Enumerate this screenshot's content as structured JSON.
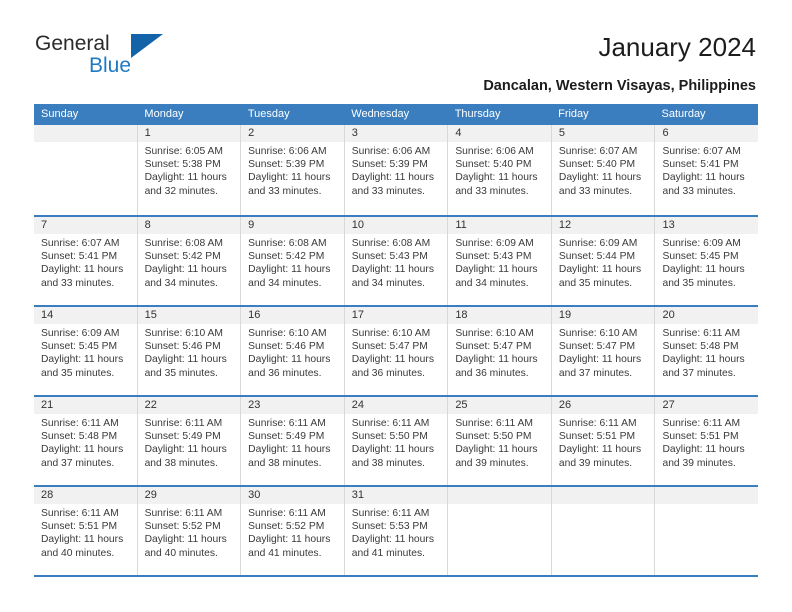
{
  "brand": {
    "line1": "General",
    "line2": "Blue",
    "logo_icon": "triangle-logo-icon",
    "blue": "#1f7ac4"
  },
  "header": {
    "title": "January 2024",
    "subtitle": "Dancalan, Western Visayas, Philippines"
  },
  "colors": {
    "header_blue": "#3a7ebf",
    "day_band_gray": "#f1f1f1",
    "text": "#3a3a3a"
  },
  "calendar": {
    "weekdays": [
      "Sunday",
      "Monday",
      "Tuesday",
      "Wednesday",
      "Thursday",
      "Friday",
      "Saturday"
    ],
    "weeks": [
      [
        {
          "day": "",
          "sunrise": "",
          "sunset": "",
          "daylight1": "",
          "daylight2": ""
        },
        {
          "day": "1",
          "sunrise": "Sunrise: 6:05 AM",
          "sunset": "Sunset: 5:38 PM",
          "daylight1": "Daylight: 11 hours",
          "daylight2": "and 32 minutes."
        },
        {
          "day": "2",
          "sunrise": "Sunrise: 6:06 AM",
          "sunset": "Sunset: 5:39 PM",
          "daylight1": "Daylight: 11 hours",
          "daylight2": "and 33 minutes."
        },
        {
          "day": "3",
          "sunrise": "Sunrise: 6:06 AM",
          "sunset": "Sunset: 5:39 PM",
          "daylight1": "Daylight: 11 hours",
          "daylight2": "and 33 minutes."
        },
        {
          "day": "4",
          "sunrise": "Sunrise: 6:06 AM",
          "sunset": "Sunset: 5:40 PM",
          "daylight1": "Daylight: 11 hours",
          "daylight2": "and 33 minutes."
        },
        {
          "day": "5",
          "sunrise": "Sunrise: 6:07 AM",
          "sunset": "Sunset: 5:40 PM",
          "daylight1": "Daylight: 11 hours",
          "daylight2": "and 33 minutes."
        },
        {
          "day": "6",
          "sunrise": "Sunrise: 6:07 AM",
          "sunset": "Sunset: 5:41 PM",
          "daylight1": "Daylight: 11 hours",
          "daylight2": "and 33 minutes."
        }
      ],
      [
        {
          "day": "7",
          "sunrise": "Sunrise: 6:07 AM",
          "sunset": "Sunset: 5:41 PM",
          "daylight1": "Daylight: 11 hours",
          "daylight2": "and 33 minutes."
        },
        {
          "day": "8",
          "sunrise": "Sunrise: 6:08 AM",
          "sunset": "Sunset: 5:42 PM",
          "daylight1": "Daylight: 11 hours",
          "daylight2": "and 34 minutes."
        },
        {
          "day": "9",
          "sunrise": "Sunrise: 6:08 AM",
          "sunset": "Sunset: 5:42 PM",
          "daylight1": "Daylight: 11 hours",
          "daylight2": "and 34 minutes."
        },
        {
          "day": "10",
          "sunrise": "Sunrise: 6:08 AM",
          "sunset": "Sunset: 5:43 PM",
          "daylight1": "Daylight: 11 hours",
          "daylight2": "and 34 minutes."
        },
        {
          "day": "11",
          "sunrise": "Sunrise: 6:09 AM",
          "sunset": "Sunset: 5:43 PM",
          "daylight1": "Daylight: 11 hours",
          "daylight2": "and 34 minutes."
        },
        {
          "day": "12",
          "sunrise": "Sunrise: 6:09 AM",
          "sunset": "Sunset: 5:44 PM",
          "daylight1": "Daylight: 11 hours",
          "daylight2": "and 35 minutes."
        },
        {
          "day": "13",
          "sunrise": "Sunrise: 6:09 AM",
          "sunset": "Sunset: 5:45 PM",
          "daylight1": "Daylight: 11 hours",
          "daylight2": "and 35 minutes."
        }
      ],
      [
        {
          "day": "14",
          "sunrise": "Sunrise: 6:09 AM",
          "sunset": "Sunset: 5:45 PM",
          "daylight1": "Daylight: 11 hours",
          "daylight2": "and 35 minutes."
        },
        {
          "day": "15",
          "sunrise": "Sunrise: 6:10 AM",
          "sunset": "Sunset: 5:46 PM",
          "daylight1": "Daylight: 11 hours",
          "daylight2": "and 35 minutes."
        },
        {
          "day": "16",
          "sunrise": "Sunrise: 6:10 AM",
          "sunset": "Sunset: 5:46 PM",
          "daylight1": "Daylight: 11 hours",
          "daylight2": "and 36 minutes."
        },
        {
          "day": "17",
          "sunrise": "Sunrise: 6:10 AM",
          "sunset": "Sunset: 5:47 PM",
          "daylight1": "Daylight: 11 hours",
          "daylight2": "and 36 minutes."
        },
        {
          "day": "18",
          "sunrise": "Sunrise: 6:10 AM",
          "sunset": "Sunset: 5:47 PM",
          "daylight1": "Daylight: 11 hours",
          "daylight2": "and 36 minutes."
        },
        {
          "day": "19",
          "sunrise": "Sunrise: 6:10 AM",
          "sunset": "Sunset: 5:47 PM",
          "daylight1": "Daylight: 11 hours",
          "daylight2": "and 37 minutes."
        },
        {
          "day": "20",
          "sunrise": "Sunrise: 6:11 AM",
          "sunset": "Sunset: 5:48 PM",
          "daylight1": "Daylight: 11 hours",
          "daylight2": "and 37 minutes."
        }
      ],
      [
        {
          "day": "21",
          "sunrise": "Sunrise: 6:11 AM",
          "sunset": "Sunset: 5:48 PM",
          "daylight1": "Daylight: 11 hours",
          "daylight2": "and 37 minutes."
        },
        {
          "day": "22",
          "sunrise": "Sunrise: 6:11 AM",
          "sunset": "Sunset: 5:49 PM",
          "daylight1": "Daylight: 11 hours",
          "daylight2": "and 38 minutes."
        },
        {
          "day": "23",
          "sunrise": "Sunrise: 6:11 AM",
          "sunset": "Sunset: 5:49 PM",
          "daylight1": "Daylight: 11 hours",
          "daylight2": "and 38 minutes."
        },
        {
          "day": "24",
          "sunrise": "Sunrise: 6:11 AM",
          "sunset": "Sunset: 5:50 PM",
          "daylight1": "Daylight: 11 hours",
          "daylight2": "and 38 minutes."
        },
        {
          "day": "25",
          "sunrise": "Sunrise: 6:11 AM",
          "sunset": "Sunset: 5:50 PM",
          "daylight1": "Daylight: 11 hours",
          "daylight2": "and 39 minutes."
        },
        {
          "day": "26",
          "sunrise": "Sunrise: 6:11 AM",
          "sunset": "Sunset: 5:51 PM",
          "daylight1": "Daylight: 11 hours",
          "daylight2": "and 39 minutes."
        },
        {
          "day": "27",
          "sunrise": "Sunrise: 6:11 AM",
          "sunset": "Sunset: 5:51 PM",
          "daylight1": "Daylight: 11 hours",
          "daylight2": "and 39 minutes."
        }
      ],
      [
        {
          "day": "28",
          "sunrise": "Sunrise: 6:11 AM",
          "sunset": "Sunset: 5:51 PM",
          "daylight1": "Daylight: 11 hours",
          "daylight2": "and 40 minutes."
        },
        {
          "day": "29",
          "sunrise": "Sunrise: 6:11 AM",
          "sunset": "Sunset: 5:52 PM",
          "daylight1": "Daylight: 11 hours",
          "daylight2": "and 40 minutes."
        },
        {
          "day": "30",
          "sunrise": "Sunrise: 6:11 AM",
          "sunset": "Sunset: 5:52 PM",
          "daylight1": "Daylight: 11 hours",
          "daylight2": "and 41 minutes."
        },
        {
          "day": "31",
          "sunrise": "Sunrise: 6:11 AM",
          "sunset": "Sunset: 5:53 PM",
          "daylight1": "Daylight: 11 hours",
          "daylight2": "and 41 minutes."
        },
        {
          "day": "",
          "sunrise": "",
          "sunset": "",
          "daylight1": "",
          "daylight2": ""
        },
        {
          "day": "",
          "sunrise": "",
          "sunset": "",
          "daylight1": "",
          "daylight2": ""
        },
        {
          "day": "",
          "sunrise": "",
          "sunset": "",
          "daylight1": "",
          "daylight2": ""
        }
      ]
    ]
  }
}
